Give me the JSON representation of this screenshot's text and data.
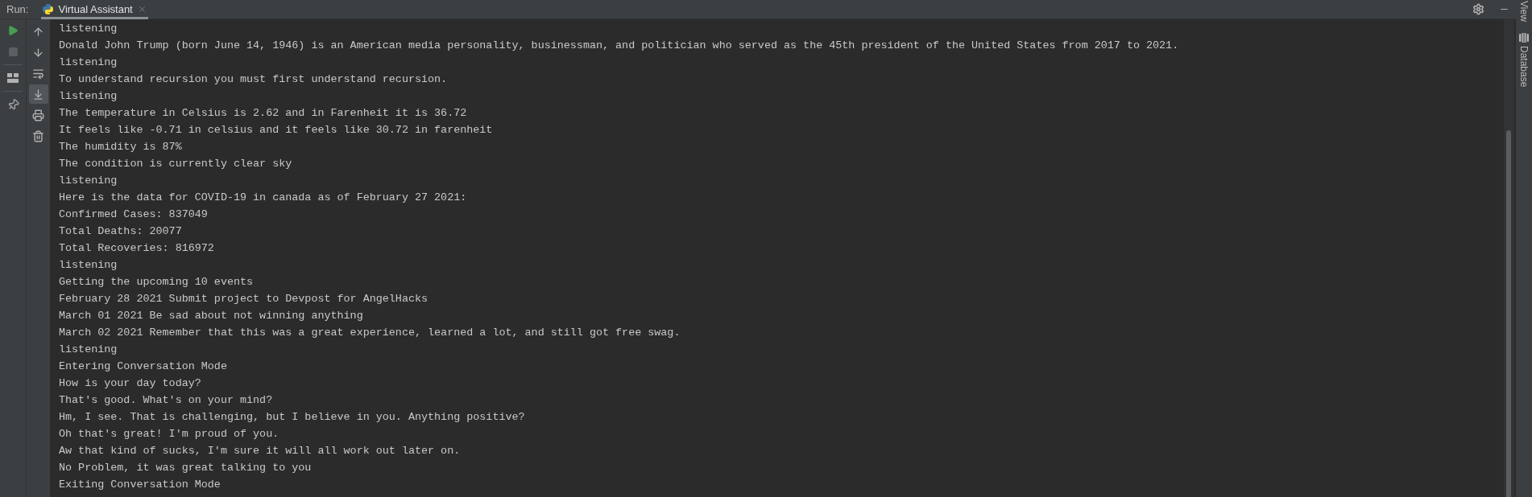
{
  "run_panel": {
    "title": "Run:",
    "tabs": [
      {
        "label": "Virtual Assistant",
        "selected": true
      }
    ]
  },
  "left_toolbar": {
    "groups": [
      [
        {
          "kind": "run",
          "disabled": false
        },
        {
          "kind": "stop",
          "disabled": true
        }
      ],
      [
        {
          "kind": "layout",
          "disabled": false
        }
      ],
      [
        {
          "kind": "pin",
          "disabled": false
        }
      ]
    ]
  },
  "console_toolbar": [
    {
      "kind": "up",
      "selected": false
    },
    {
      "kind": "down",
      "selected": false
    },
    {
      "kind": "soft_wrap",
      "selected": false
    },
    {
      "kind": "scroll_to_end",
      "selected": true
    },
    {
      "kind": "print",
      "selected": false
    },
    {
      "kind": "trash",
      "selected": false
    }
  ],
  "console": {
    "lines": [
      "listening",
      "Donald John Trump (born June 14, 1946) is an American media personality, businessman, and politician who served as the 45th president of the United States from 2017 to 2021.",
      "listening",
      "To understand recursion you must first understand recursion.",
      "listening",
      "The temperature in Celsius is 2.62 and in Farenheit it is 36.72",
      "It feels like -0.71 in celsius and it feels like 30.72 in farenheit",
      "The humidity is 87%",
      "The condition is currently clear sky",
      "listening",
      "Here is the data for COVID-19 in canada as of February 27 2021:",
      "Confirmed Cases: 837049",
      "Total Deaths: 20077",
      "Total Recoveries: 816972",
      "listening",
      "Getting the upcoming 10 events",
      "February 28 2021 Submit project to Devpost for AngelHacks",
      "March 01 2021 Be sad about not winning anything",
      "March 02 2021 Remember that this was a great experience, learned a lot, and still got free swag.",
      "listening",
      "Entering Conversation Mode",
      "How is your day today?",
      "That's good. What's on your mind?",
      "Hm, I see. That is challenging, but I believe in you. Anything positive?",
      "Oh that's great! I'm proud of you.",
      "Aw that kind of sucks, I'm sure it will all work out later on.",
      "No Problem, it was great talking to you",
      "Exiting Conversation Mode"
    ]
  },
  "right_strip": {
    "tabs": [
      {
        "label": "View",
        "kind": "text"
      },
      {
        "label": "Database",
        "kind": "database"
      }
    ]
  }
}
